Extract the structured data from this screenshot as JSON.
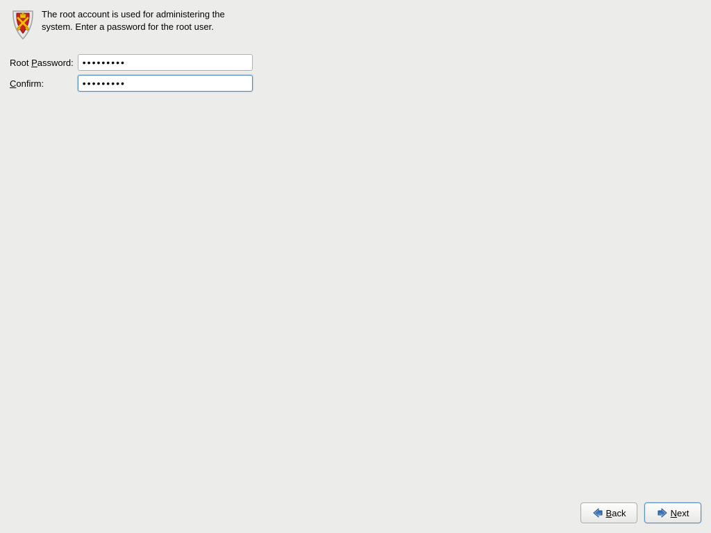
{
  "header": {
    "description": "The root account is used for administering the system.  Enter a password for the root user."
  },
  "form": {
    "password_label_pre": "Root ",
    "password_label_u": "P",
    "password_label_post": "assword:",
    "password_value": "•••••••••",
    "confirm_label_u": "C",
    "confirm_label_post": "onfirm:",
    "confirm_value": "•••••••••"
  },
  "buttons": {
    "back_u": "B",
    "back_post": "ack",
    "next_u": "N",
    "next_post": "ext"
  }
}
